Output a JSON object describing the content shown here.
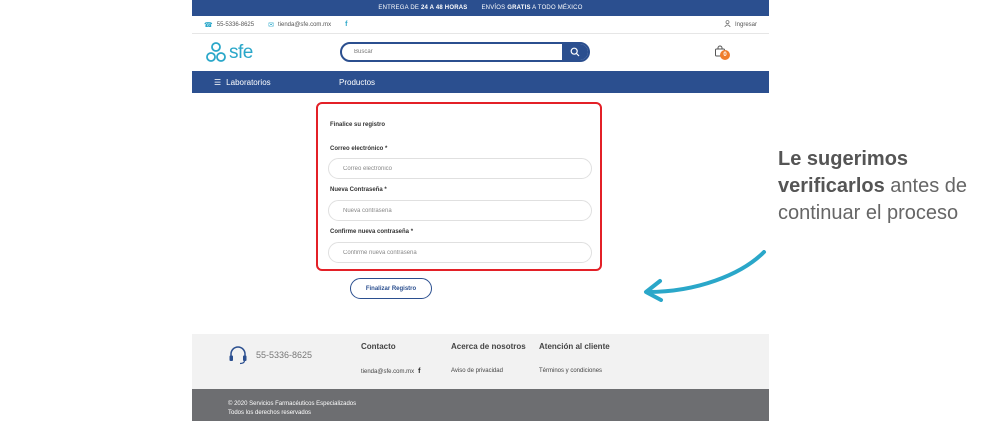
{
  "promo": {
    "part1": "ENTREGA DE ",
    "part1_bold": "24 A 48 HORAS",
    "part2": "ENVÍOS ",
    "part2_bold": "GRATIS",
    "part2_rest": " A TODO MÉXICO"
  },
  "topbar": {
    "phone": "55-5336-8625",
    "email": "tienda@sfe.com.mx",
    "facebook": "f",
    "login": "Ingresar"
  },
  "header": {
    "logo_text": "sfe",
    "search_placeholder": "Buscar",
    "cart_count": "0"
  },
  "nav": {
    "labs": "Laboratorios",
    "products": "Productos"
  },
  "form": {
    "title": "Finalice su registro",
    "email_label": "Correo electrónico *",
    "email_placeholder": "Correo electrónico",
    "password_label": "Nueva Contraseña *",
    "password_placeholder": "Nueva contraseña",
    "confirm_label": "Confirme nueva contraseña *",
    "confirm_placeholder": "Confirme nueva contraseña",
    "submit": "Finalizar Registro"
  },
  "footer": {
    "phone": "55-5336-8625",
    "contact_heading": "Contacto",
    "contact_email": "tienda@sfe.com.mx",
    "contact_fb": "f",
    "about_heading": "Acerca de nosotros",
    "privacy": "Aviso de privacidad",
    "support_heading": "Atención al cliente",
    "terms": "Términos y condiciones",
    "copyright": "© 2020 Servicios Farmacéuticos Especializados",
    "rights": "Todos los derechos reservados"
  },
  "annotation": {
    "bold": "Le sugerimos verificarlos",
    "rest": " antes de continuar el proceso"
  },
  "colors": {
    "brand_blue": "#2b4f8f",
    "accent_cyan": "#2aa7c9",
    "highlight_red": "#e32027",
    "badge_orange": "#f07d2c"
  }
}
